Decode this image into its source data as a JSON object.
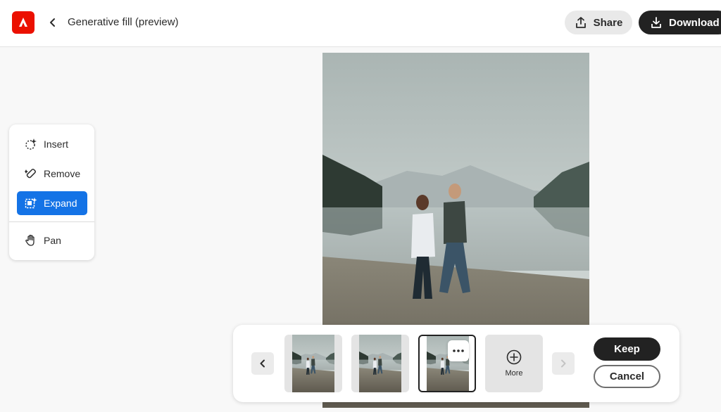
{
  "header": {
    "title": "Generative fill (preview)",
    "share_label": "Share",
    "download_label": "Download"
  },
  "tools": {
    "items": [
      {
        "label": "Insert",
        "icon": "insert-icon",
        "active": false
      },
      {
        "label": "Remove",
        "icon": "remove-icon",
        "active": false
      },
      {
        "label": "Expand",
        "icon": "expand-icon",
        "active": true
      },
      {
        "label": "Pan",
        "icon": "hand-icon",
        "active": false
      }
    ]
  },
  "canvas": {
    "image": "photo-couple-walking-lakeshore"
  },
  "variations": {
    "thumbnail_count": 3,
    "selected_index": 3,
    "more_label": "More",
    "keep_label": "Keep",
    "cancel_label": "Cancel"
  },
  "colors": {
    "accent": "#1473e6",
    "brand": "#eb1000",
    "primary_button": "#222222"
  }
}
